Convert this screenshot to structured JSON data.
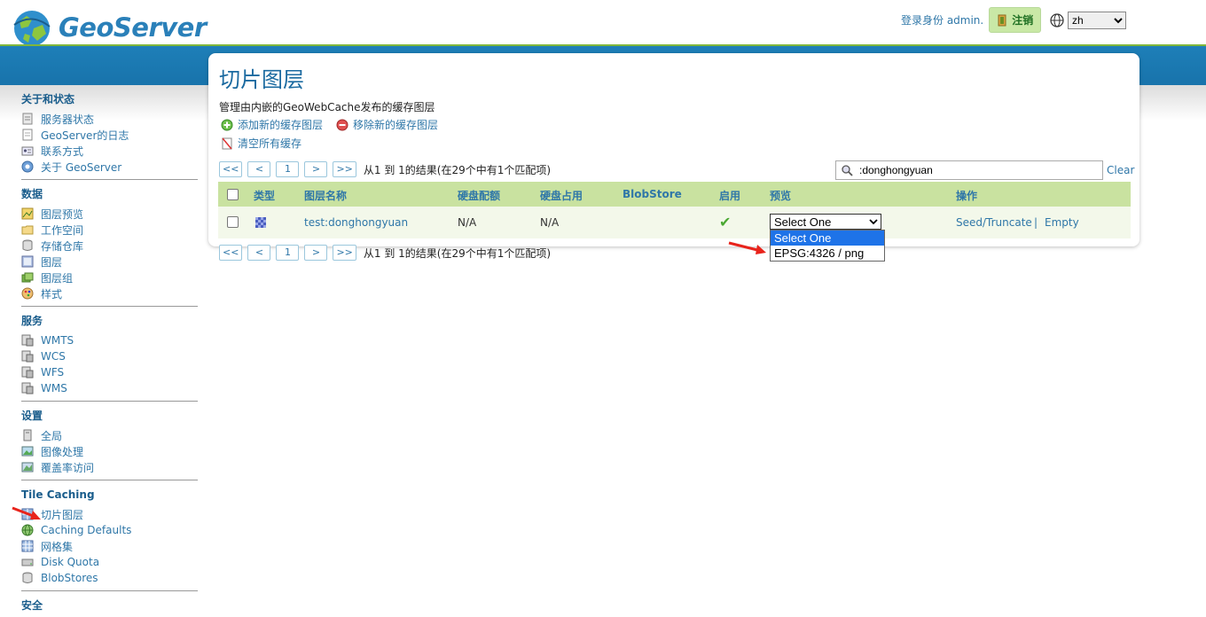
{
  "header": {
    "logo_text": "GeoServer",
    "login_text": "登录身份 admin.",
    "logout_label": "注销",
    "language": "zh"
  },
  "sidebar": {
    "sections": [
      {
        "title": "关于和状态",
        "items": [
          "服务器状态",
          "GeoServer的日志",
          "联系方式",
          "关于 GeoServer"
        ]
      },
      {
        "title": "数据",
        "items": [
          "图层预览",
          "工作空间",
          "存储仓库",
          "图层",
          "图层组",
          "样式"
        ]
      },
      {
        "title": "服务",
        "items": [
          "WMTS",
          "WCS",
          "WFS",
          "WMS"
        ]
      },
      {
        "title": "设置",
        "items": [
          "全局",
          "图像处理",
          "覆盖率访问"
        ]
      },
      {
        "title": "Tile Caching",
        "items": [
          "切片图层",
          "Caching Defaults",
          "网格集",
          "Disk Quota",
          "BlobStores"
        ]
      },
      {
        "title": "安全",
        "items": []
      }
    ]
  },
  "main": {
    "title": "切片图层",
    "description": "管理由内嵌的GeoWebCache发布的缓存图层",
    "add_link": "添加新的缓存图层",
    "remove_link": "移除新的缓存图层",
    "clear_link": "清空所有缓存",
    "pager": {
      "first": "<<",
      "prev": "<",
      "page": "1",
      "next": ">",
      "last": ">>",
      "info": "从1 到 1的结果(在29个中有1个匹配项)"
    },
    "search_value": ":donghongyuan",
    "search_clear": "Clear",
    "columns": [
      "类型",
      "图层名称",
      "硬盘配额",
      "硬盘占用",
      "BlobStore",
      "启用",
      "预览",
      "操作"
    ],
    "rows": [
      {
        "name": "test:donghongyuan",
        "quota": "N/A",
        "usage": "N/A",
        "blobstore": "",
        "enabled": "✔",
        "preview_selected": "Select One",
        "action_seed": "Seed/Truncate",
        "action_sep": "|",
        "action_empty": "Empty"
      }
    ],
    "preview_options": [
      "Select One",
      "EPSG:4326 / png"
    ]
  },
  "colors": {
    "band_blue": "#1e7fb8",
    "link_blue": "#2f77a8",
    "table_header_green": "#c9e2a0",
    "dropdown_selected": "#1e73e8",
    "annotation_arrow": "#e8231b"
  }
}
